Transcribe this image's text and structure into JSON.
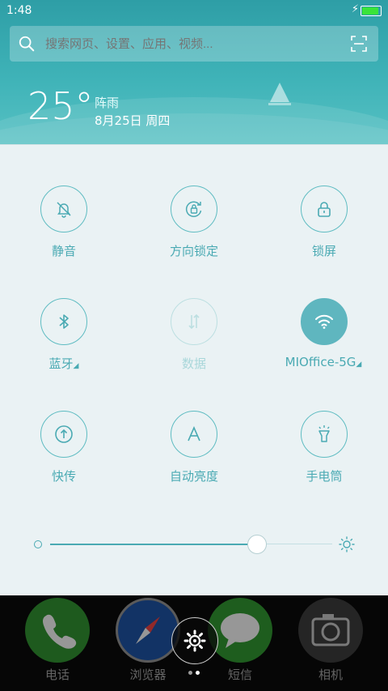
{
  "status": {
    "time": "1:48",
    "battery_level": 1.0
  },
  "search": {
    "placeholder": "搜索网页、设置、应用、视频..."
  },
  "weather": {
    "temp": "25°",
    "condition": "阵雨",
    "date": "8月25日 周四"
  },
  "toggles": [
    {
      "label": "静音",
      "icon": "bell-off-icon",
      "state": "off"
    },
    {
      "label": "方向锁定",
      "icon": "rotation-lock-icon",
      "state": "off"
    },
    {
      "label": "锁屏",
      "icon": "lock-icon",
      "state": "off"
    },
    {
      "label": "蓝牙",
      "icon": "bluetooth-icon",
      "state": "off",
      "has_menu": true
    },
    {
      "label": "数据",
      "icon": "mobile-data-icon",
      "state": "disabled"
    },
    {
      "label": "MIOffice-5G",
      "icon": "wifi-icon",
      "state": "on",
      "has_menu": true
    },
    {
      "label": "快传",
      "icon": "share-upload-icon",
      "state": "off"
    },
    {
      "label": "自动亮度",
      "icon": "auto-brightness-icon",
      "state": "off"
    },
    {
      "label": "手电筒",
      "icon": "flashlight-icon",
      "state": "off"
    }
  ],
  "brightness": {
    "level": 0.73
  },
  "dock": {
    "apps": [
      {
        "label": "电话",
        "icon": "phone-icon",
        "color": "#2e8b2e"
      },
      {
        "label": "浏览器",
        "icon": "compass-icon",
        "color": "#1d4f9b"
      },
      {
        "label": "短信",
        "icon": "message-icon",
        "color": "#2f8f2f"
      },
      {
        "label": "相机",
        "icon": "camera-icon",
        "color": "#3a3a3a"
      }
    ],
    "current_page": 1,
    "pages": 2
  },
  "colors": {
    "accent": "#4aaab3",
    "header": "#3fb3b8",
    "panel": "#eaf2f4"
  }
}
